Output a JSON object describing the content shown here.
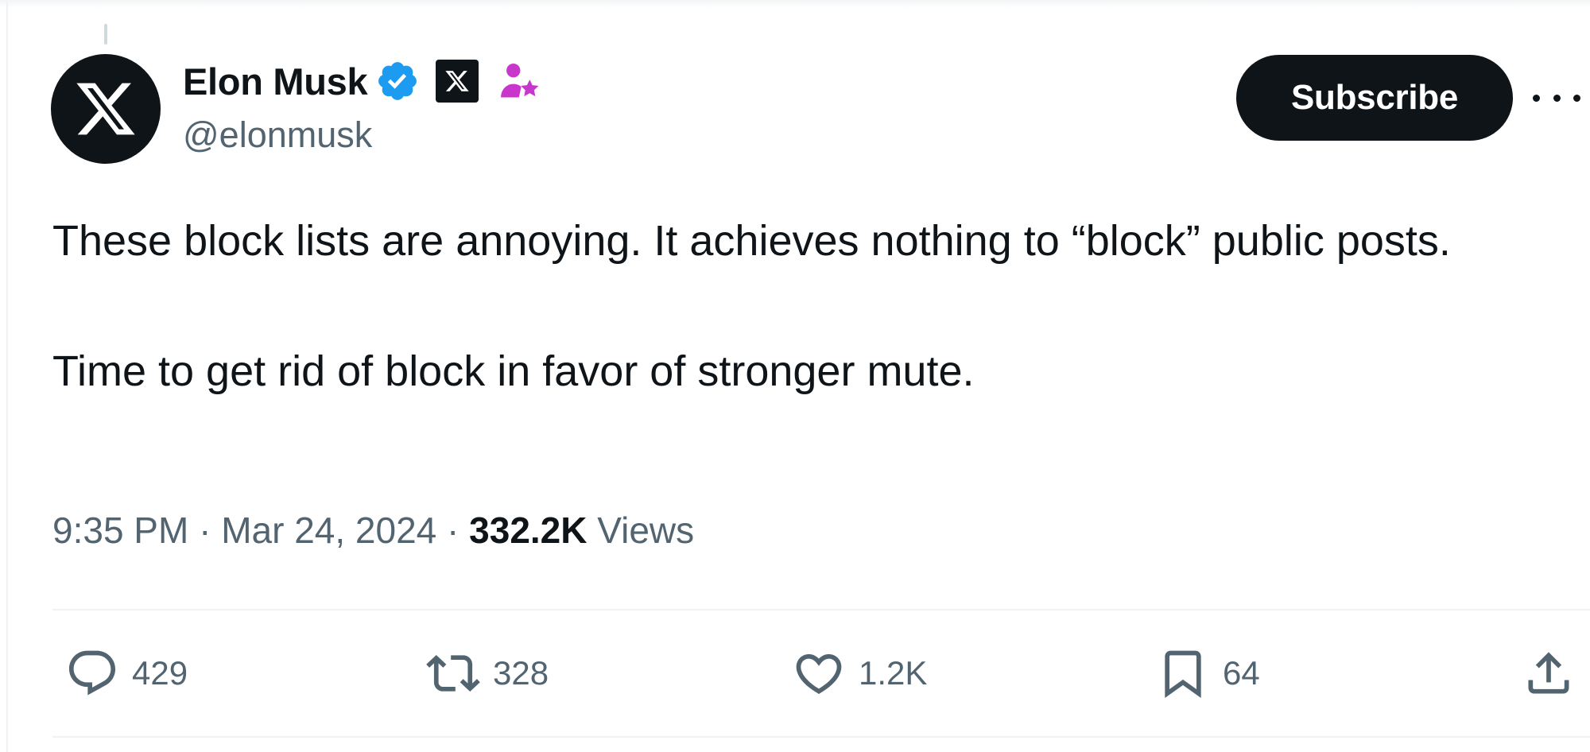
{
  "author": {
    "display_name": "Elon Musk",
    "handle": "@elonmusk",
    "avatar_icon": "x-logo-icon",
    "badges": [
      "verified-badge-icon",
      "x-affiliate-icon",
      "person-star-icon"
    ]
  },
  "header": {
    "subscribe_label": "Subscribe",
    "more_icon": "more-horizontal-icon"
  },
  "tweet": {
    "text": "These block lists are annoying. It achieves nothing to “block” public posts.\n\nTime to get rid of block in favor of stronger mute.",
    "time": "9:35 PM",
    "separator": " · ",
    "date": "Mar 24, 2024",
    "views_count": "332.2K",
    "views_label": "Views"
  },
  "actions": {
    "reply": {
      "icon": "reply-icon",
      "count": "429"
    },
    "repost": {
      "icon": "repost-icon",
      "count": "328"
    },
    "like": {
      "icon": "heart-icon",
      "count": "1.2K"
    },
    "bookmark": {
      "icon": "bookmark-icon",
      "count": "64"
    },
    "share": {
      "icon": "share-icon"
    }
  },
  "colors": {
    "text_primary": "#0f1419",
    "text_secondary": "#536471",
    "verified_blue": "#1d9bf0",
    "badge_magenta": "#c936cc",
    "divider": "#eff3f4"
  }
}
